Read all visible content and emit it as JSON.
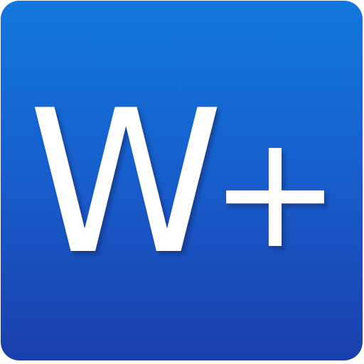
{
  "app_icon": {
    "letter": "W",
    "symbol": "+",
    "colors": {
      "gradient_top": "#1178dc",
      "gradient_mid": "#1760cf",
      "gradient_bottom": "#1a3fac",
      "glyph": "#ffffff",
      "shadow": "#0a2a6a"
    }
  }
}
